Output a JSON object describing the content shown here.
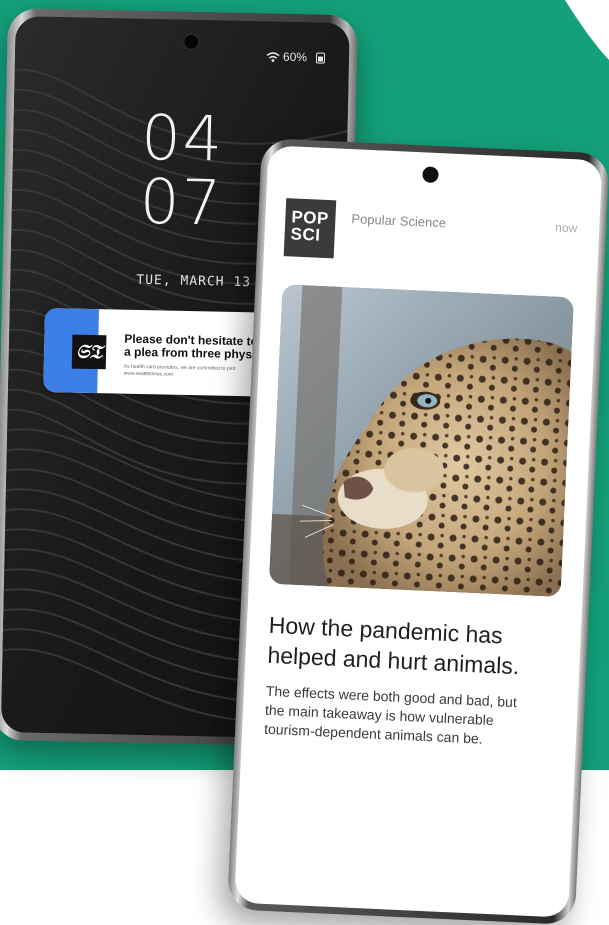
{
  "colors": {
    "background_accent": "#14a07a",
    "notification_accent": "#3d7fe8",
    "popsci_logo": "#3b3b3b"
  },
  "lock_screen": {
    "status": {
      "battery": "60%",
      "icons": [
        "wifi-icon",
        "battery-icon"
      ]
    },
    "clock_hour": "04",
    "clock_minute": "07",
    "date": "TUE, MARCH 13",
    "notification": {
      "source_logo": "𝔖𝔗",
      "title": "Please don't hesitate to va\na plea from three physician",
      "body": "As health care providers, we are committed to prot\nwww.seattletimes.com"
    }
  },
  "article_notification": {
    "logo_text": "POP\nSCI",
    "app_name": "Popular Science",
    "time": "now",
    "image_icon": "leopard-photo",
    "headline": "How the pandemic has\nhelped and hurt animals.",
    "summary": "The effects were both good and bad, but\nthe main takeaway is how vulnerable\ntourism-dependent animals can be."
  }
}
